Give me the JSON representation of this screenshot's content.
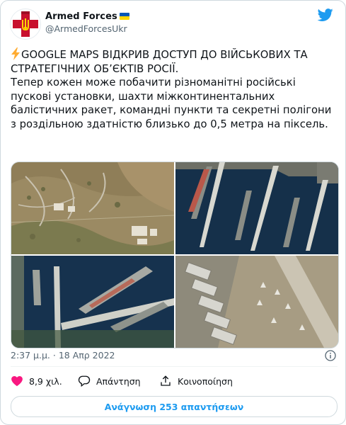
{
  "account": {
    "display_name": "Armed Forces",
    "handle": "@ArmedForcesUkr",
    "avatar_icon": "ukraine-armed-forces-emblem",
    "flag_icon": "ukraine-flag",
    "flag_colors": [
      "#0057b7",
      "#ffd700"
    ]
  },
  "tweet": {
    "headline": "GOOGLE MAPS ВІДКРИВ ДОСТУП ДО ВІЙСЬКОВИХ ТА СТРАТЕГІЧНИХ ОБ’ЄКТІВ РОСІЇ.",
    "body": "Тепер кожен може побачити різноманітні російські пускові установки, шахти міжконтинентальних балістичних ракет, командні пункти та секретні полігони з роздільною здатністю близько до 0,5 метра на піксель.",
    "lead_icon": "lightning-icon"
  },
  "media": {
    "images": [
      {
        "name": "launch-site-satellite-image"
      },
      {
        "name": "naval-piers-satellite-image"
      },
      {
        "name": "warships-harbor-satellite-image"
      },
      {
        "name": "airfield-hangars-satellite-image"
      }
    ]
  },
  "meta": {
    "timestamp": "2:37 μ.μ. · 18 Απρ 2022"
  },
  "actions": {
    "like_count": "8,9 χιλ.",
    "reply_label": "Απάντηση",
    "share_label": "Κοινοποίηση"
  },
  "footer": {
    "read_replies_label": "Ανάγνωση 253 απαντήσεων"
  },
  "colors": {
    "twitter_blue": "#1d9bf0",
    "like_red": "#f91880",
    "secondary_text": "#536471"
  }
}
